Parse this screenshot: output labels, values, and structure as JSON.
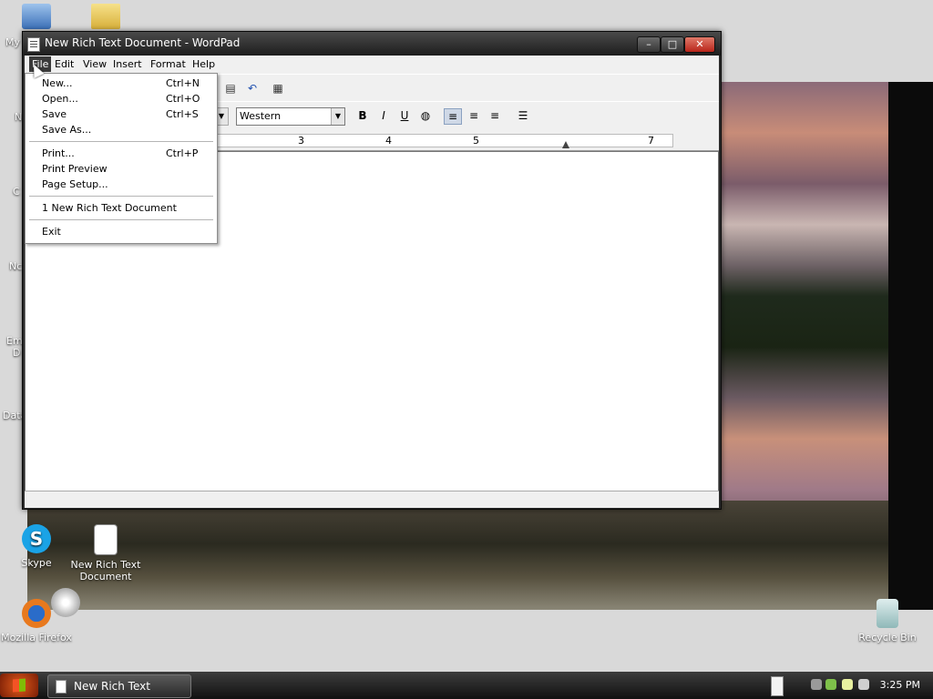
{
  "desktop": {
    "icons": [
      {
        "id": "skype",
        "label": "Skype"
      },
      {
        "id": "new-rtf",
        "label": "New Rich Text Document"
      },
      {
        "id": "firefox",
        "label": "Mozilla Firefox"
      },
      {
        "id": "recycle",
        "label": "Recycle Bin"
      }
    ],
    "partial_labels": [
      "My",
      "N",
      "C",
      "Nc",
      "Em",
      "D",
      "Data"
    ]
  },
  "window": {
    "title": "New Rich Text Document - WordPad",
    "controls": {
      "minimize": "–",
      "maximize": "□",
      "close": "✕"
    }
  },
  "menubar": [
    "File",
    "Edit",
    "View",
    "Insert",
    "Format",
    "Help"
  ],
  "format_bar": {
    "script_value": "Western",
    "bold": "B",
    "italic": "I",
    "underline": "U"
  },
  "ruler": {
    "numbers": [
      "3",
      "4",
      "5",
      "7"
    ]
  },
  "file_menu": {
    "items": [
      {
        "label": "New...",
        "shortcut": "Ctrl+N"
      },
      {
        "label": "Open...",
        "shortcut": "Ctrl+O"
      },
      {
        "label": "Save",
        "shortcut": "Ctrl+S"
      },
      {
        "label": "Save As...",
        "shortcut": ""
      },
      {
        "label": "Print...",
        "shortcut": "Ctrl+P"
      },
      {
        "label": "Print Preview",
        "shortcut": ""
      },
      {
        "label": "Page Setup...",
        "shortcut": ""
      },
      {
        "label": "1 New Rich Text Document",
        "shortcut": ""
      },
      {
        "label": "Exit",
        "shortcut": ""
      }
    ]
  },
  "taskbar": {
    "task_label": "New Rich Text Docum...",
    "clock": "3:25 PM"
  }
}
